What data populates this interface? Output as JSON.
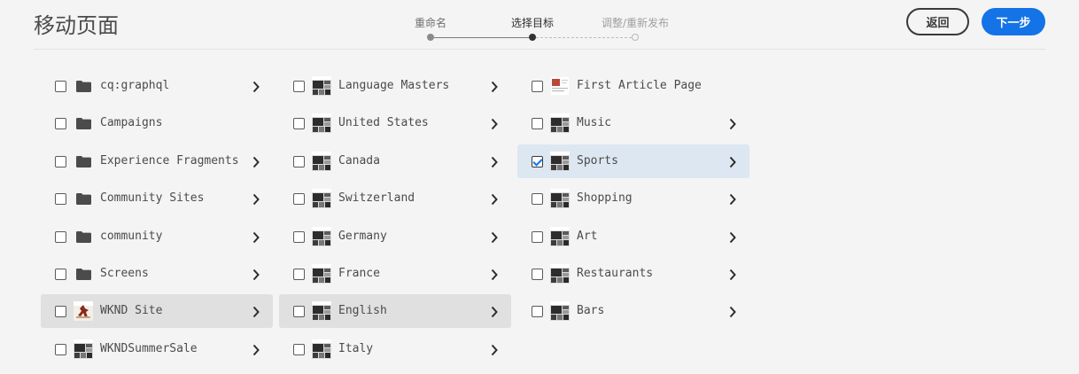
{
  "header": {
    "title": "移动页面",
    "back_label": "返回",
    "next_label": "下一步"
  },
  "wizard": {
    "steps": [
      {
        "label": "重命名",
        "state": "done"
      },
      {
        "label": "选择目标",
        "state": "current"
      },
      {
        "label": "调整/重新发布",
        "state": "todo"
      }
    ]
  },
  "columns": [
    {
      "items": [
        {
          "label": "cq:graphql",
          "icon": "folder-icon",
          "has_children": true,
          "checked": false,
          "active": false
        },
        {
          "label": "Campaigns",
          "icon": "folder-icon",
          "has_children": false,
          "checked": false,
          "active": false
        },
        {
          "label": "Experience Fragments",
          "icon": "folder-icon",
          "has_children": true,
          "checked": false,
          "active": false
        },
        {
          "label": "Community Sites",
          "icon": "folder-icon",
          "has_children": true,
          "checked": false,
          "active": false
        },
        {
          "label": "community",
          "icon": "folder-icon",
          "has_children": true,
          "checked": false,
          "active": false
        },
        {
          "label": "Screens",
          "icon": "folder-icon",
          "has_children": true,
          "checked": false,
          "active": false
        },
        {
          "label": "WKND Site",
          "icon": "page-thumbnail-runner",
          "has_children": true,
          "checked": false,
          "active": true
        },
        {
          "label": "WKNDSummerSale",
          "icon": "page-thumbnail",
          "has_children": true,
          "checked": false,
          "active": false
        }
      ]
    },
    {
      "items": [
        {
          "label": "Language Masters",
          "icon": "page-thumbnail",
          "has_children": true,
          "checked": false,
          "active": false
        },
        {
          "label": "United States",
          "icon": "page-thumbnail",
          "has_children": true,
          "checked": false,
          "active": false
        },
        {
          "label": "Canada",
          "icon": "page-thumbnail",
          "has_children": true,
          "checked": false,
          "active": false
        },
        {
          "label": "Switzerland",
          "icon": "page-thumbnail",
          "has_children": true,
          "checked": false,
          "active": false
        },
        {
          "label": "Germany",
          "icon": "page-thumbnail",
          "has_children": true,
          "checked": false,
          "active": false
        },
        {
          "label": "France",
          "icon": "page-thumbnail",
          "has_children": true,
          "checked": false,
          "active": false
        },
        {
          "label": "English",
          "icon": "page-thumbnail",
          "has_children": true,
          "checked": false,
          "active": true
        },
        {
          "label": "Italy",
          "icon": "page-thumbnail",
          "has_children": true,
          "checked": false,
          "active": false
        }
      ]
    },
    {
      "items": [
        {
          "label": "First Article Page",
          "icon": "page-thumbnail-article",
          "has_children": false,
          "checked": false,
          "active": false
        },
        {
          "label": "Music",
          "icon": "page-thumbnail",
          "has_children": true,
          "checked": false,
          "active": false
        },
        {
          "label": "Sports",
          "icon": "page-thumbnail",
          "has_children": true,
          "checked": true,
          "active": false
        },
        {
          "label": "Shopping",
          "icon": "page-thumbnail",
          "has_children": true,
          "checked": false,
          "active": false
        },
        {
          "label": "Art",
          "icon": "page-thumbnail",
          "has_children": true,
          "checked": false,
          "active": false
        },
        {
          "label": "Restaurants",
          "icon": "page-thumbnail",
          "has_children": true,
          "checked": false,
          "active": false
        },
        {
          "label": "Bars",
          "icon": "page-thumbnail",
          "has_children": true,
          "checked": false,
          "active": false
        }
      ]
    }
  ],
  "colors": {
    "accent": "#1473e6",
    "background": "#f4f4f4",
    "active_row": "#e0e0e0",
    "selected_row": "#dde7f2"
  }
}
